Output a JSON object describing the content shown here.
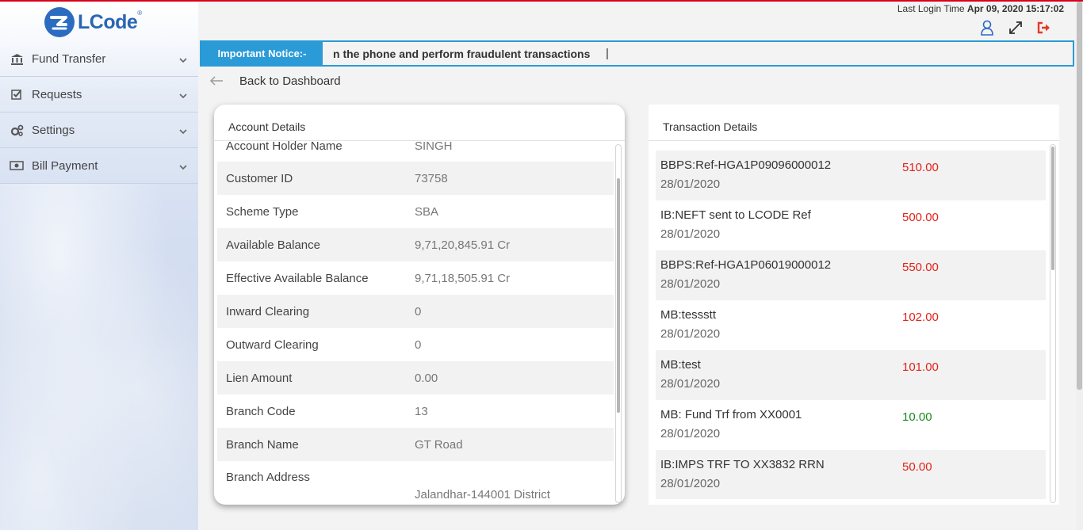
{
  "brand": {
    "name": "LCode",
    "reg": "®"
  },
  "header": {
    "last_login_label": "Last Login Time",
    "last_login_value": "Apr 09, 2020 15:17:02",
    "icons": [
      "user-icon",
      "expand-icon",
      "logout-icon"
    ]
  },
  "sidebar": {
    "items": [
      {
        "label": "Fund Transfer",
        "icon": "bank-icon"
      },
      {
        "label": "Requests",
        "icon": "check-square-icon"
      },
      {
        "label": "Settings",
        "icon": "gears-icon"
      },
      {
        "label": "Bill Payment",
        "icon": "money-bill-icon"
      }
    ]
  },
  "notice": {
    "label": "Important Notice:-",
    "text": "n the phone and perform fraudulent transactions",
    "caret": "|"
  },
  "back_link": {
    "label": "Back to Dashboard"
  },
  "account": {
    "title": "Account Details",
    "rows": [
      {
        "key": "Account Holder Name",
        "value": "SINGH"
      },
      {
        "key": "Customer ID",
        "value": "73758"
      },
      {
        "key": "Scheme Type",
        "value": "SBA"
      },
      {
        "key": "Available Balance",
        "value": "9,71,20,845.91 Cr"
      },
      {
        "key": "Effective Available Balance",
        "value": "9,71,18,505.91 Cr"
      },
      {
        "key": "Inward Clearing",
        "value": "0"
      },
      {
        "key": "Outward Clearing",
        "value": "0"
      },
      {
        "key": "Lien Amount",
        "value": "0.00"
      },
      {
        "key": "Branch Code",
        "value": "13"
      },
      {
        "key": "Branch Name",
        "value": "GT Road"
      },
      {
        "key": "Branch Address",
        "value": "Jalandhar-144001 District"
      }
    ]
  },
  "transactions": {
    "title": "Transaction Details",
    "colors": {
      "debit": "#e2231a",
      "credit": "#1a8a1a"
    },
    "rows": [
      {
        "desc": "BBPS:Ref-HGA1P09096000012",
        "date": "28/01/2020",
        "amount": "510.00",
        "type": "dr"
      },
      {
        "desc": "IB:NEFT sent to LCODE Ref",
        "date": "28/01/2020",
        "amount": "500.00",
        "type": "dr"
      },
      {
        "desc": "BBPS:Ref-HGA1P06019000012",
        "date": "28/01/2020",
        "amount": "550.00",
        "type": "dr"
      },
      {
        "desc": "MB:tessstt",
        "date": "28/01/2020",
        "amount": "102.00",
        "type": "dr"
      },
      {
        "desc": "MB:test",
        "date": "28/01/2020",
        "amount": "101.00",
        "type": "dr"
      },
      {
        "desc": "MB: Fund Trf from XX0001",
        "date": "28/01/2020",
        "amount": "10.00",
        "type": "cr"
      },
      {
        "desc": "IB:IMPS TRF TO XX3832 RRN",
        "date": "28/01/2020",
        "amount": "50.00",
        "type": "dr"
      }
    ]
  }
}
